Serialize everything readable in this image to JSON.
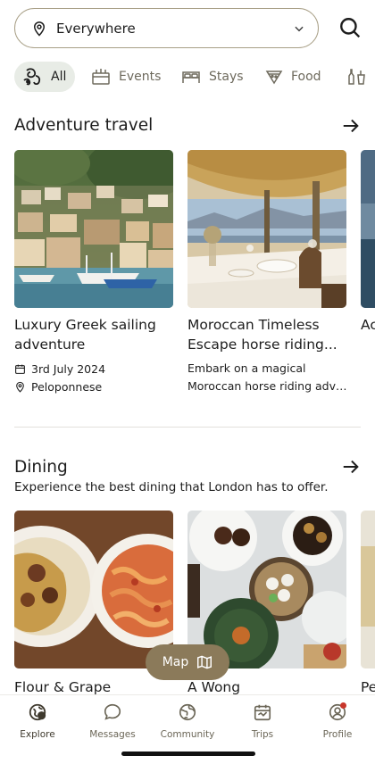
{
  "search": {
    "location_label": "Everywhere",
    "location_icon": "map-pin-icon",
    "dropdown_icon": "chevron-down-icon",
    "search_icon": "search-icon"
  },
  "categories": [
    {
      "label": "All",
      "icon": "all-icon",
      "active": true
    },
    {
      "label": "Events",
      "icon": "events-icon",
      "active": false
    },
    {
      "label": "Stays",
      "icon": "bed-icon",
      "active": false
    },
    {
      "label": "Food",
      "icon": "food-icon",
      "active": false
    },
    {
      "label": "",
      "icon": "drinks-icon",
      "active": false
    }
  ],
  "adventure": {
    "title": "Adventure travel",
    "cards": [
      {
        "title": "Luxury Greek sailing adventure",
        "date": "3rd July 2024",
        "location": "Peloponnese"
      },
      {
        "title": "Moroccan Timeless Escape horse riding...",
        "desc_line1": "Embark on a magical",
        "desc_line2": "Moroccan horse riding adve..."
      },
      {
        "title": "Ac Bo",
        "partial": true
      }
    ]
  },
  "dining": {
    "title": "Dining",
    "subtitle": "Experience the best dining that London has to offer.",
    "cards": [
      {
        "title": "Flour & Grape"
      },
      {
        "title": "A Wong"
      },
      {
        "title": "Pe"
      }
    ]
  },
  "map_button": {
    "label": "Map",
    "icon": "map-icon"
  },
  "bottom_nav": [
    {
      "label": "Explore",
      "icon": "explore-icon",
      "active": true
    },
    {
      "label": "Messages",
      "icon": "chat-bubble-icon",
      "active": false
    },
    {
      "label": "Community",
      "icon": "globe-icon",
      "active": false
    },
    {
      "label": "Trips",
      "icon": "trips-icon",
      "active": false
    },
    {
      "label": "Profile",
      "icon": "profile-icon",
      "active": false,
      "badge": true
    }
  ],
  "colors": {
    "accent": "#8b7a5a",
    "chip_active_bg": "#e8ece6",
    "notification": "#c8362b"
  }
}
